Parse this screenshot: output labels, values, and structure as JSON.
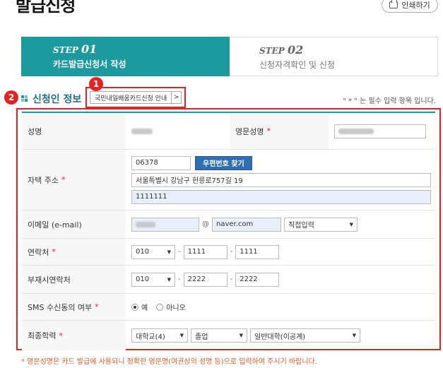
{
  "page": {
    "title": "발급신청",
    "print_label": "인쇄하기"
  },
  "steps": [
    {
      "step": "STEP",
      "num": "01",
      "label": "카드발급신청서 작성"
    },
    {
      "step": "STEP",
      "num": "02",
      "label": "신청자격확인 및 신청"
    }
  ],
  "badges": [
    "1",
    "2"
  ],
  "section": {
    "title": "신청인 정보",
    "guide_button": "국민내일배움카드신청 안내",
    "guide_arrow": ">",
    "required_note_prefix": "\" ",
    "required_star": "*",
    "required_note_suffix": " \" 는 필수 입력 항목 입니다."
  },
  "form": {
    "name_label": "성명",
    "eng_name_label": "영문성명",
    "address_label": "자택 주소",
    "zipcode": "06378",
    "zip_button": "우편번호 찾기",
    "address1": "서울특별시 강남구 헌릉로757길 19",
    "address2": "1111111",
    "email_label": "이메일 (e-mail)",
    "email_at": "@",
    "email_domain": "naver.com",
    "email_select": "직접입력",
    "phone_label": "연락처",
    "phone": [
      "010",
      "1111",
      "1111"
    ],
    "alt_phone_label": "부재시연락처",
    "alt_phone": [
      "010",
      "2222",
      "2222"
    ],
    "sms_label": "SMS 수신동의 여부",
    "sms_yes": "예",
    "sms_no": "아니오",
    "edu_label": "최종학력",
    "edu_level": "대학교(4)",
    "edu_status": "졸업",
    "edu_type": "일반대학(이공계)",
    "dash": "-",
    "star": "*",
    "arrow": "▼"
  },
  "footer_note": "* 영문성명은 카드 발급에 사용되니 정확한 영문명(여권상의 성명 등)으로 입력하여 주시기 바랍니다.",
  "colors": {
    "teal": "#1d9a9d",
    "red": "#e52222",
    "blue_button": "#2f6db5"
  }
}
